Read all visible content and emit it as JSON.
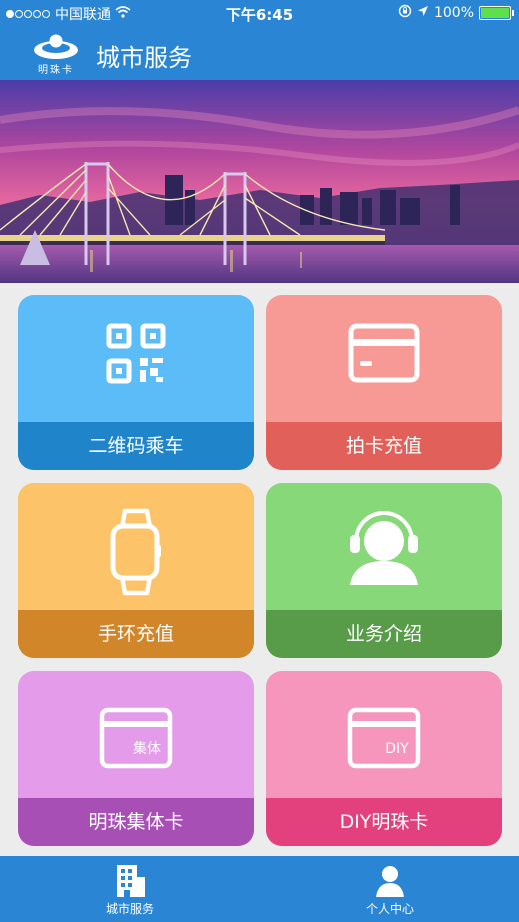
{
  "status": {
    "carrier": "中国联通",
    "time": "下午6:45",
    "battery": "100%"
  },
  "header": {
    "logo_text": "明珠卡",
    "title": "城市服务"
  },
  "banner": {
    "page_indicator": 1
  },
  "tiles": [
    {
      "label": "二维码乘车",
      "icon": "qr-code-icon",
      "color": "#5bbcf7",
      "bar": "#1f84c9"
    },
    {
      "label": "拍卡充值",
      "icon": "card-icon",
      "color": "#f79a96",
      "bar": "#e2605a"
    },
    {
      "label": "手环充值",
      "icon": "watch-icon",
      "color": "#fcc368",
      "bar": "#d1862a"
    },
    {
      "label": "业务介绍",
      "icon": "headset-person-icon",
      "color": "#86d878",
      "bar": "#589c49"
    },
    {
      "label": "明珠集体卡",
      "icon": "group-card-icon",
      "badge": "集体",
      "color": "#e39bea",
      "bar": "#a84fb6"
    },
    {
      "label": "DIY明珠卡",
      "icon": "diy-card-icon",
      "badge": "DIY",
      "color": "#f796bd",
      "bar": "#e3407e"
    }
  ],
  "tabbar": {
    "items": [
      {
        "label": "城市服务",
        "icon": "city-building-icon"
      },
      {
        "label": "个人中心",
        "icon": "person-icon"
      }
    ]
  }
}
